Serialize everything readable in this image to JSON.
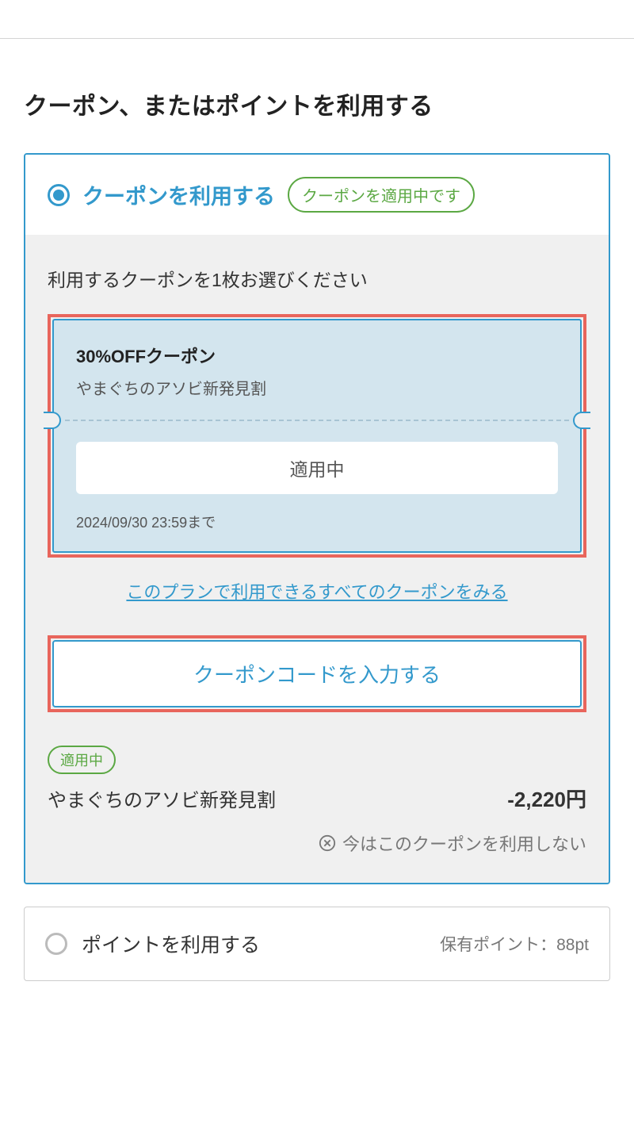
{
  "page": {
    "title": "クーポン、またはポイントを利用する"
  },
  "coupon_section": {
    "header_title": "クーポンを利用する",
    "applied_badge": "クーポンを適用中です",
    "instruction": "利用するクーポンを1枚お選びください"
  },
  "coupon_card": {
    "name": "30%OFFクーポン",
    "subtitle": "やまぐちのアソビ新発見割",
    "applied_label": "適用中",
    "expiry": "2024/09/30 23:59まで"
  },
  "links": {
    "view_all": "このプランで利用できるすべてのクーポンをみる",
    "code_input": "クーポンコードを入力する"
  },
  "applied_discount": {
    "tag": "適用中",
    "name": "やまぐちのアソビ新発見割",
    "amount": "-2,220円",
    "remove_label": "今はこのクーポンを利用しない"
  },
  "points_section": {
    "title": "ポイントを利用する",
    "balance": "保有ポイント：88pt"
  }
}
